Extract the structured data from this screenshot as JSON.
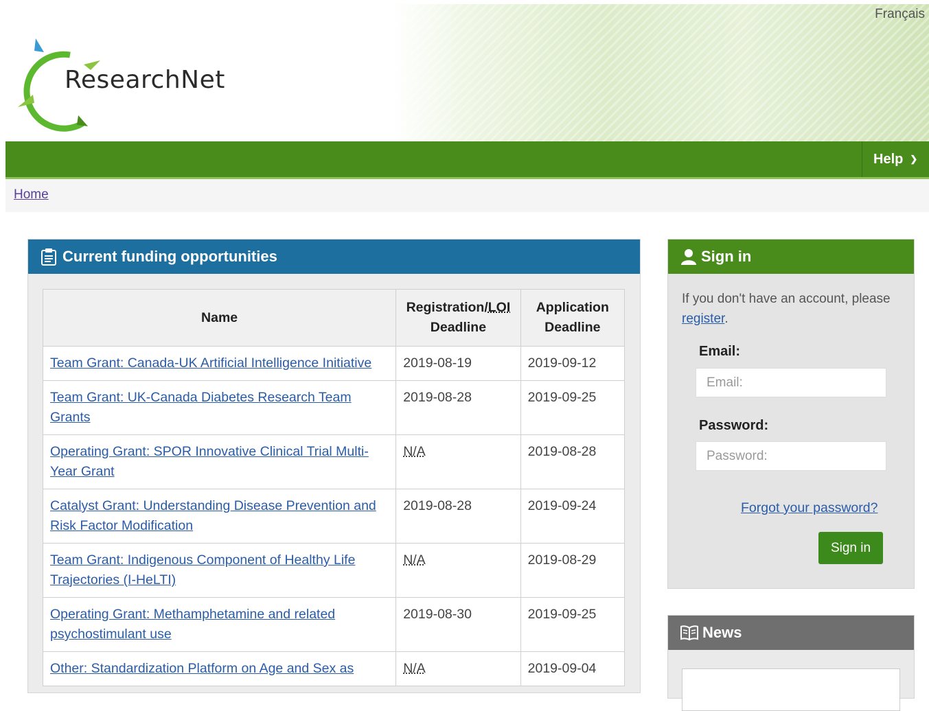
{
  "header": {
    "language_link": "Français",
    "logo_text_bold": "Research",
    "logo_text_light": "Net"
  },
  "nav": {
    "help_label": "Help"
  },
  "breadcrumb": {
    "home": "Home"
  },
  "funding": {
    "title": "Current funding opportunities",
    "columns": [
      "Name",
      "Registration/LOI Deadline",
      "Application Deadline"
    ],
    "col_reg_a": "Registration/",
    "col_reg_abbr": "LOI",
    "col_reg_b": "Deadline",
    "col_app_a": "Application",
    "col_app_b": "Deadline",
    "rows": [
      {
        "name": "Team Grant: Canada-UK Artificial Intelligence Initiative",
        "registration": "2019-08-19",
        "application": "2019-09-12"
      },
      {
        "name": "Team Grant: UK-Canada Diabetes Research Team Grants",
        "registration": "2019-08-28",
        "application": "2019-09-25"
      },
      {
        "name": "Operating Grant: SPOR Innovative Clinical Trial Multi-Year Grant",
        "registration": "N/A",
        "application": "2019-08-28"
      },
      {
        "name": "Catalyst Grant: Understanding Disease Prevention and Risk Factor Modification",
        "registration": "2019-08-28",
        "application": "2019-09-24"
      },
      {
        "name": "Team Grant: Indigenous Component of Healthy Life Trajectories (I-HeLTI)",
        "registration": "N/A",
        "application": "2019-08-29"
      },
      {
        "name": "Operating Grant: Methamphetamine and related psychostimulant use",
        "registration": "2019-08-30",
        "application": "2019-09-25"
      },
      {
        "name": "Other: Standardization Platform on Age and Sex as",
        "registration": "N/A",
        "application": "2019-09-04"
      }
    ]
  },
  "signin": {
    "title": "Sign in",
    "intro_text": "If you don't have an account, please",
    "register_link": "register",
    "intro_end": ".",
    "email_label": "Email:",
    "email_placeholder": "Email:",
    "password_label": "Password:",
    "password_placeholder": "Password:",
    "forgot_link": "Forgot your password?",
    "button": "Sign in"
  },
  "news": {
    "title": "News"
  },
  "colors": {
    "nav_green": "#4a8c1c",
    "funding_blue": "#1d6f9f",
    "news_gray": "#6f6f6f",
    "link_blue": "#2a5ca8"
  }
}
